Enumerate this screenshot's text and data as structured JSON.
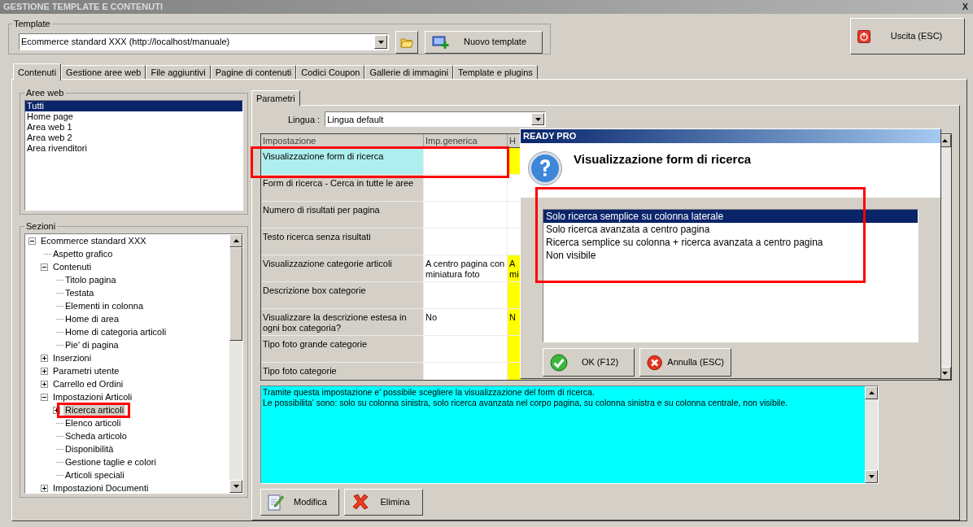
{
  "window": {
    "title": "GESTIONE TEMPLATE E CONTENUTI",
    "close": "X"
  },
  "template": {
    "label": "Template",
    "value": "Ecommerce standard XXX (http://localhost/manuale)",
    "new_button": "Nuovo template"
  },
  "exit_button": "Uscita (ESC)",
  "tabs": [
    {
      "label": "Contenuti",
      "selected": true
    },
    {
      "label": "Gestione aree web",
      "selected": false
    },
    {
      "label": "File aggiuntivi",
      "selected": false
    },
    {
      "label": "Pagine di contenuti",
      "selected": false
    },
    {
      "label": "Codici Coupon",
      "selected": false
    },
    {
      "label": "Gallerie di immagini",
      "selected": false
    },
    {
      "label": "Template e plugins",
      "selected": false
    }
  ],
  "web_areas": {
    "label": "Aree web",
    "items": [
      {
        "label": "Tutti",
        "selected": true
      },
      {
        "label": "Home page",
        "selected": false
      },
      {
        "label": "Area web 1",
        "selected": false
      },
      {
        "label": "Area web 2",
        "selected": false
      },
      {
        "label": "Area rivenditori",
        "selected": false
      }
    ]
  },
  "sections": {
    "label": "Sezioni",
    "tree": [
      {
        "label": "Ecommerce standard XXX",
        "selected": false,
        "expanded": true,
        "children": [
          {
            "label": "Aspetto grafico",
            "selected": false
          },
          {
            "label": "Contenuti",
            "selected": false,
            "expanded": true,
            "children": [
              {
                "label": "Titolo pagina",
                "selected": false
              },
              {
                "label": "Testata",
                "selected": false
              },
              {
                "label": "Elementi in colonna",
                "selected": false
              },
              {
                "label": "Home di area",
                "selected": false
              },
              {
                "label": "Home di categoria articoli",
                "selected": false
              },
              {
                "label": "Pie' di pagina",
                "selected": false
              }
            ]
          },
          {
            "label": "Inserzioni",
            "selected": false,
            "expanded": false
          },
          {
            "label": "Parametri utente",
            "selected": false,
            "expanded": false
          },
          {
            "label": "Carrello ed Ordini",
            "selected": false,
            "expanded": false
          },
          {
            "label": "Impostazioni Articoli",
            "selected": false,
            "expanded": true,
            "children": [
              {
                "label": "Ricerca articoli",
                "selected": true,
                "expanded": false
              },
              {
                "label": "Elenco articoli",
                "selected": false
              },
              {
                "label": "Scheda articolo",
                "selected": false
              },
              {
                "label": "Disponibilità",
                "selected": false
              },
              {
                "label": "Gestione taglie e colori",
                "selected": false
              },
              {
                "label": "Articoli speciali",
                "selected": false
              }
            ]
          },
          {
            "label": "Impostazioni Documenti",
            "selected": false,
            "expanded": false
          }
        ]
      }
    ]
  },
  "params": {
    "tab": {
      "label": "Parametri",
      "selected": true
    },
    "language_label": "Lingua :",
    "language": "Lingua default",
    "table": {
      "columns": [
        "Impostazione",
        "Imp.generica",
        "H"
      ],
      "rows": [
        {
          "setting": "Visualizzazione form di ricerca",
          "generic": "",
          "column_3": "",
          "highlighted": true,
          "selected": true
        },
        {
          "setting": "Form di ricerca - Cerca in tutte le aree",
          "generic": "",
          "column_3": "",
          "highlighted": false,
          "selected": false
        },
        {
          "setting": "Numero di risultati per pagina",
          "generic": "",
          "column_3": "",
          "highlighted": false,
          "selected": false
        },
        {
          "setting": "Testo ricerca senza risultati",
          "generic": "",
          "column_3": "",
          "highlighted": false,
          "selected": false
        },
        {
          "setting": "Visualizzazione categorie articoli",
          "generic": "A centro pagina con miniatura foto",
          "column_3": "A mi",
          "highlighted": true,
          "selected": false
        },
        {
          "setting": "Descrizione box categorie",
          "generic": "",
          "column_3": "",
          "highlighted": true,
          "selected": false
        },
        {
          "setting": "Visualizzare la descrizione estesa in ogni box categoria?",
          "generic": "No",
          "column_3": "N",
          "highlighted": true,
          "selected": false
        },
        {
          "setting": "Tipo foto grande categorie",
          "generic": "",
          "column_3": "",
          "highlighted": true,
          "selected": false
        },
        {
          "setting": "Tipo foto categorie",
          "generic": "",
          "column_3": "",
          "highlighted": true,
          "selected": false
        }
      ]
    },
    "description": [
      "Tramite questa impostazione e' possibile scegliere la visualizzazione del form di ricerca.",
      "Le possibilita' sono: solo su colonna sinistra, solo ricerca avanzata nel corpo pagina, su colonna sinistra e su colonna centrale, non visibile."
    ],
    "edit_button": "Modifica",
    "delete_button": "Elimina"
  },
  "dialog": {
    "title": "READY PRO",
    "heading": "Visualizzazione form di ricerca",
    "options": [
      {
        "label": "Solo ricerca semplice su colonna laterale",
        "selected": true
      },
      {
        "label": "Solo ricerca avanzata a centro pagina",
        "selected": false
      },
      {
        "label": "Ricerca semplice su colonna + ricerca avanzata a centro pagina",
        "selected": false
      },
      {
        "label": "Non visibile",
        "selected": false
      }
    ],
    "ok": "OK (F12)",
    "cancel": "Annulla (ESC)"
  }
}
